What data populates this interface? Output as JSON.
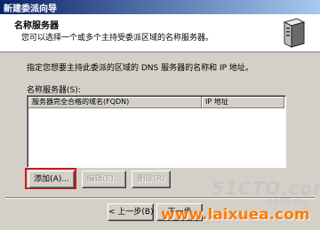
{
  "window": {
    "title": "新建委派向导"
  },
  "header": {
    "title": "名称服务器",
    "description": "您可以选择一个或多个主持受委派区域的名称服务器。"
  },
  "instruction": "指定您想要主持此委派的区域的 DNS 服务器的名称和 IP 地址。",
  "name_servers": {
    "label": "名称服务器(S):",
    "columns": [
      "服务器完全合格的域名(FQDN)",
      "IP 地址"
    ],
    "rows": []
  },
  "buttons": {
    "add": "添加(A)...",
    "edit": "编辑(E)...",
    "remove": "删除(R)",
    "back": "< 上一步(B)",
    "next": "下一步"
  },
  "watermarks": {
    "site1": "51CTO.com",
    "site1_sub": "技术博客 Blog",
    "site2": "www.laixuea.com"
  },
  "colors": {
    "titlebar": "#0a246a",
    "highlight": "#d01818",
    "watermark": "#ff7a00"
  }
}
